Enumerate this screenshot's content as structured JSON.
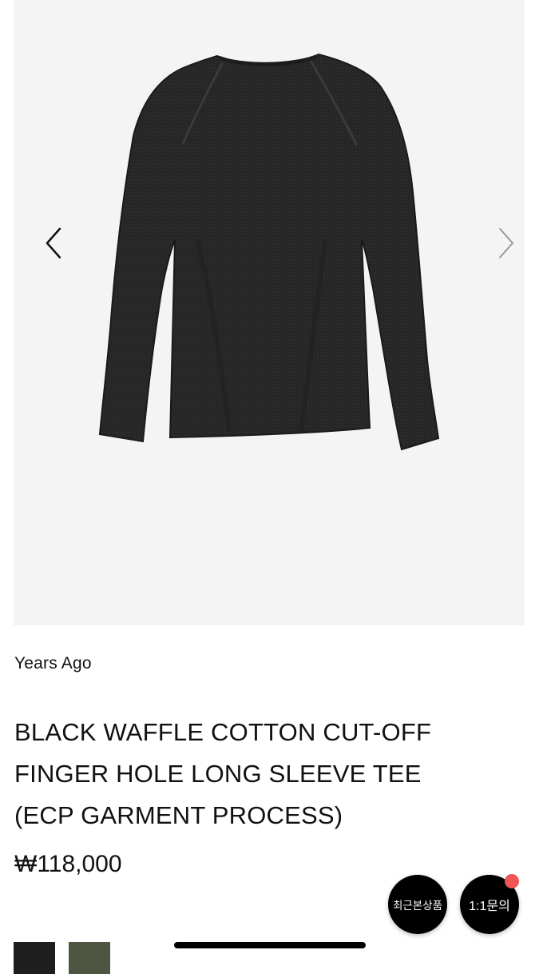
{
  "gallery": {
    "image_alt": "black long sleeve tee back view",
    "prev_icon": "chevron-left-icon",
    "next_icon": "chevron-right-icon",
    "background_color": "#f4f4f4"
  },
  "product": {
    "brand": "Years Ago",
    "title": "BLACK WAFFLE COTTON CUT-OFF\nFINGER HOLE LONG SLEEVE TEE\n(ECP GARMENT PROCESS)",
    "price": "₩118,000"
  },
  "floating_buttons": {
    "recent_label": "최근본상품",
    "inquiry_label": "1:1문의",
    "notification_color": "#f05656"
  },
  "swatches": [
    {
      "name": "black",
      "color": "#1e1e1e"
    },
    {
      "name": "olive",
      "color": "#4e5540"
    }
  ]
}
